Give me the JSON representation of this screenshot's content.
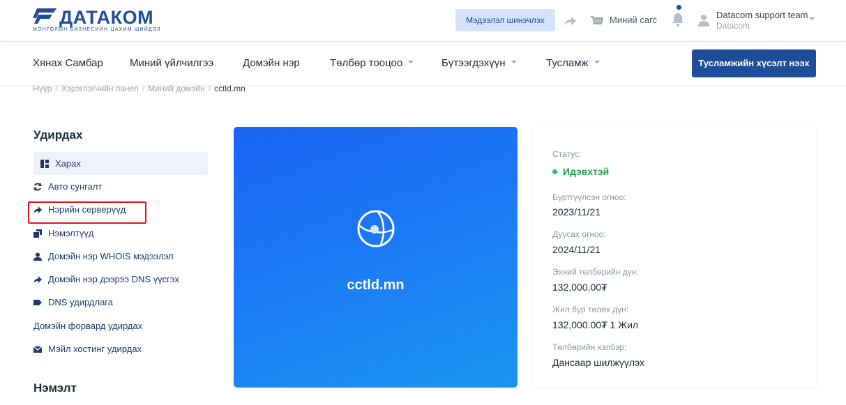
{
  "brand": {
    "name": "ДАТАКОМ",
    "tagline": "МОНГОЛЫН БИЗНЕСИЙН ЦАХИМ ШИЙДЭЛ",
    "color": "#1e4e98"
  },
  "header": {
    "update_label": "Мэдээлэл шинэчлэх",
    "cart_label": "Миний сагс",
    "user_name": "Datacom support team",
    "user_org": "Datacom"
  },
  "nav": {
    "items": [
      {
        "label": "Хянах Самбар"
      },
      {
        "label": "Миний үйлчилгээ"
      },
      {
        "label": "Домэйн нэр"
      },
      {
        "label": "Төлбөр тооцоо"
      },
      {
        "label": "Бүтээгдэхүүн"
      },
      {
        "label": "Тусламж"
      }
    ],
    "help_button": "Тусламжийн хүсэлт нээх"
  },
  "breadcrumb": [
    "Нүүр",
    "Хэрэглэгчийн панел",
    "Миний домэйн",
    "cctld.mn"
  ],
  "sidebar": {
    "title": "Удирдах",
    "items": [
      {
        "label": "Харах",
        "icon": "dashboard-icon"
      },
      {
        "label": "Авто сунгалт",
        "icon": "refresh-icon"
      },
      {
        "label": "Нэрийн серверүүд",
        "icon": "arrow-right-icon"
      },
      {
        "label": "Нэмэлтүүд",
        "icon": "addons-icon"
      },
      {
        "label": "Домэйн нэр WHOIS мэдээлэл",
        "icon": "user-icon"
      },
      {
        "label": "Домэйн нэр дээрээ DNS үүсгэх",
        "icon": "arrow-right-icon"
      },
      {
        "label": "DNS удирдлага",
        "icon": "tag-icon"
      },
      {
        "label": "Домэйн форвард удирдах",
        "icon": ""
      },
      {
        "label": "Мэйл хостинг удирдах",
        "icon": "mail-icon"
      }
    ],
    "section2_title": "Нэмэлт"
  },
  "domain": {
    "name": "cctld.mn"
  },
  "info": {
    "status_label": "Статус:",
    "status_value": "Идэвхтэй",
    "registered_label": "Бүртгүүлсэн огноо:",
    "registered_value": "2023/11/21",
    "expiry_label": "Дуусах огноо:",
    "expiry_value": "2024/11/21",
    "first_payment_label": "Эхний төлбөрийн дүн:",
    "first_payment_value": "132,000.00₮",
    "recurring_label": "Жил бүр төлөх дүн:",
    "recurring_value": "132,000.00₮ 1 Жил",
    "method_label": "Төлбөрийн хэлбэр:",
    "method_value": "Дансаар шилжүүлэх"
  }
}
